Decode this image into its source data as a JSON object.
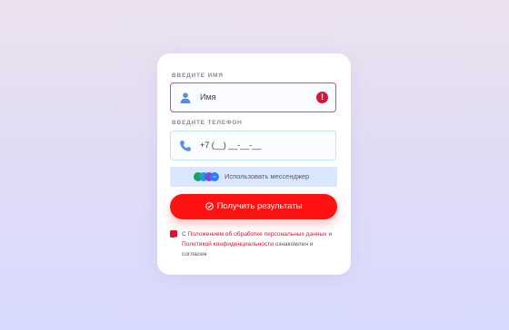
{
  "form": {
    "name_label": "ВВЕДИТЕ ИМЯ",
    "name_placeholder": "Имя",
    "phone_label": "ВВЕДИТЕ ТЕЛЕФОН",
    "phone_value": "+7 (__) __-__-__",
    "messenger_label": "Использовать мессенджер",
    "submit_label": "Получить результаты",
    "consent": {
      "prefix": "С ",
      "link1": "Положением об обработке персональных данных",
      "mid": " и ",
      "link2": "Политикой конфиденциальности",
      "suffix": " ознакомлен и согласен"
    }
  },
  "colors": {
    "accent": "#ff1212",
    "error": "#d6163d",
    "messenger_bg": "#d9e8ff"
  },
  "icons": [
    "user-icon",
    "error-icon",
    "phone-icon",
    "messenger-icons",
    "check-circle-icon",
    "checkbox-checked-icon"
  ]
}
